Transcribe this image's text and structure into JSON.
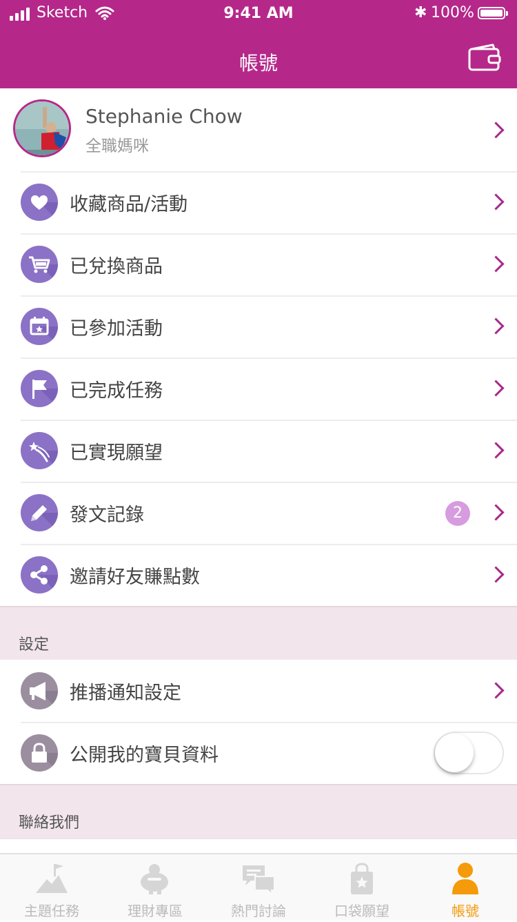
{
  "status_bar": {
    "carrier": "Sketch",
    "time": "9:41 AM",
    "battery": "100%"
  },
  "header": {
    "title": "帳號"
  },
  "profile": {
    "name": "Stephanie Chow",
    "subtitle": "全職媽咪"
  },
  "menu": {
    "items": [
      {
        "label": "收藏商品/活動",
        "icon": "heart-icon"
      },
      {
        "label": "已兌換商品",
        "icon": "cart-icon"
      },
      {
        "label": "已參加活動",
        "icon": "calendar-icon"
      },
      {
        "label": "已完成任務",
        "icon": "flag-icon"
      },
      {
        "label": "已實現願望",
        "icon": "shooting-star-icon"
      },
      {
        "label": "發文記錄",
        "icon": "pencil-icon",
        "badge": "2"
      },
      {
        "label": "邀請好友賺點數",
        "icon": "share-icon"
      }
    ]
  },
  "settings": {
    "section_title": "設定",
    "items": [
      {
        "label": "推播通知設定",
        "icon": "megaphone-icon"
      },
      {
        "label": "公開我的寶貝資料",
        "icon": "lock-icon",
        "toggle_on": false
      }
    ]
  },
  "contact": {
    "section_title": "聯絡我們"
  },
  "tab_bar": {
    "tabs": [
      {
        "label": "主題任務",
        "icon": "mountain-flag-icon",
        "active": false
      },
      {
        "label": "理財專區",
        "icon": "piggy-bank-icon",
        "active": false
      },
      {
        "label": "熱門討論",
        "icon": "chat-bubbles-icon",
        "active": false
      },
      {
        "label": "口袋願望",
        "icon": "wish-bag-icon",
        "active": false
      },
      {
        "label": "帳號",
        "icon": "person-icon",
        "active": true
      }
    ]
  },
  "colors": {
    "brand": "#B5288A",
    "icon_purple": "#8B72C6",
    "icon_gray": "#9A8E9F",
    "badge": "#D79BDF",
    "tab_active": "#F59A0B",
    "section_bg": "#F2E6EC"
  }
}
